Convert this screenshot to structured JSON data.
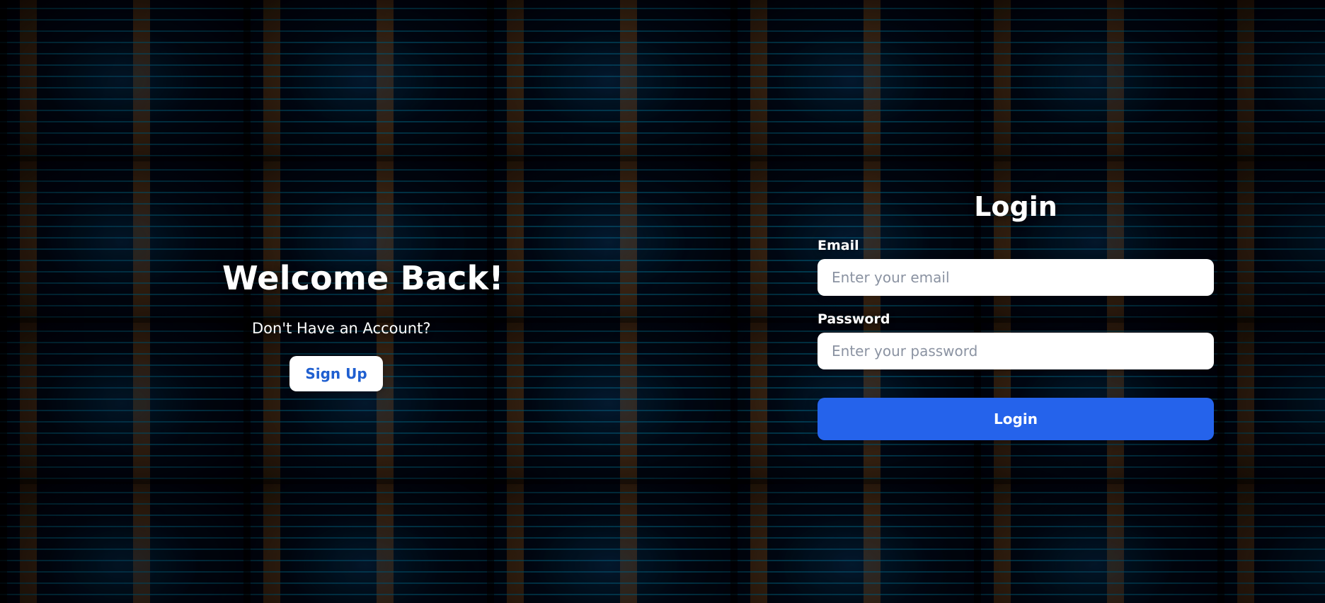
{
  "left_panel": {
    "title": "Welcome Back!",
    "subtitle": "Don't Have an Account?",
    "signup_label": "Sign Up"
  },
  "login_panel": {
    "title": "Login",
    "email_label": "Email",
    "email_placeholder": "Enter your email",
    "email_value": "",
    "password_label": "Password",
    "password_placeholder": "Enter your password",
    "password_value": "",
    "login_button_label": "Login"
  },
  "colors": {
    "primary_blue": "#2563eb",
    "signup_text_blue": "#1f5fd0"
  }
}
